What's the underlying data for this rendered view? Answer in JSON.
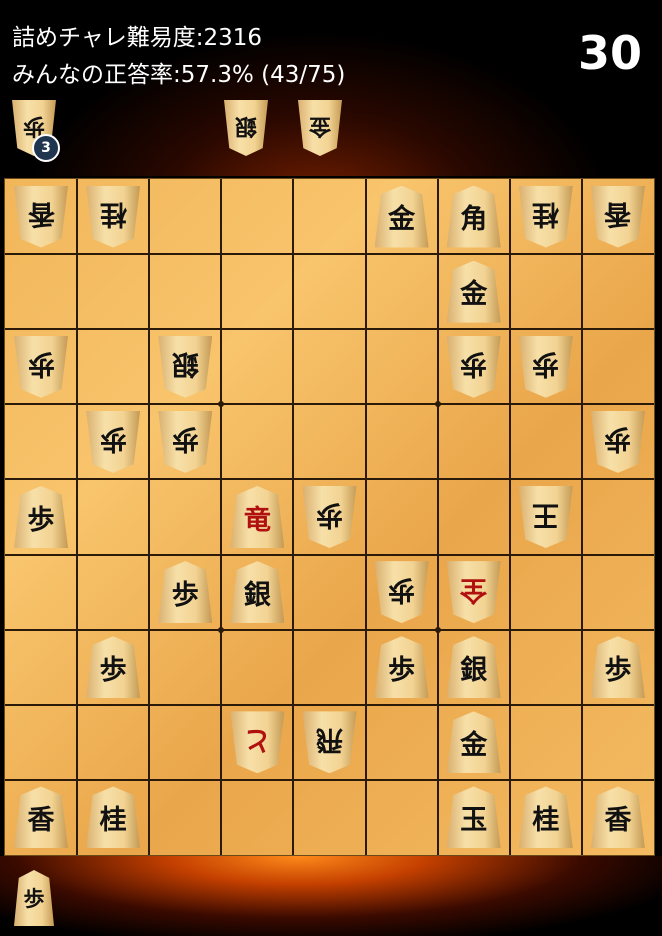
{
  "header": {
    "difficulty_text": "詰めチャレ難易度:2316",
    "accuracy_text": "みんなの正答率:57.3% (43/75)",
    "timer": "30"
  },
  "hands": {
    "opponent": [
      {
        "kanji": "歩",
        "count": "3"
      },
      {
        "kanji": "銀",
        "count": ""
      },
      {
        "kanji": "金",
        "count": ""
      }
    ],
    "player": [
      {
        "kanji": "歩",
        "count": ""
      }
    ]
  },
  "board": {
    "files": 9,
    "ranks": 9,
    "pieces": [
      {
        "row": 0,
        "col": 0,
        "kanji": "香",
        "owner": "gote"
      },
      {
        "row": 0,
        "col": 1,
        "kanji": "桂",
        "owner": "gote"
      },
      {
        "row": 0,
        "col": 5,
        "kanji": "金",
        "owner": "sente"
      },
      {
        "row": 0,
        "col": 6,
        "kanji": "角",
        "owner": "sente"
      },
      {
        "row": 0,
        "col": 7,
        "kanji": "桂",
        "owner": "gote"
      },
      {
        "row": 0,
        "col": 8,
        "kanji": "香",
        "owner": "gote"
      },
      {
        "row": 1,
        "col": 6,
        "kanji": "金",
        "owner": "sente"
      },
      {
        "row": 2,
        "col": 0,
        "kanji": "歩",
        "owner": "gote"
      },
      {
        "row": 2,
        "col": 2,
        "kanji": "銀",
        "owner": "gote"
      },
      {
        "row": 2,
        "col": 6,
        "kanji": "歩",
        "owner": "gote"
      },
      {
        "row": 2,
        "col": 7,
        "kanji": "歩",
        "owner": "gote"
      },
      {
        "row": 3,
        "col": 1,
        "kanji": "歩",
        "owner": "gote"
      },
      {
        "row": 3,
        "col": 2,
        "kanji": "歩",
        "owner": "gote"
      },
      {
        "row": 3,
        "col": 8,
        "kanji": "歩",
        "owner": "gote"
      },
      {
        "row": 4,
        "col": 0,
        "kanji": "歩",
        "owner": "sente"
      },
      {
        "row": 4,
        "col": 3,
        "kanji": "竜",
        "owner": "sente",
        "red": true
      },
      {
        "row": 4,
        "col": 4,
        "kanji": "歩",
        "owner": "gote"
      },
      {
        "row": 4,
        "col": 7,
        "kanji": "王",
        "owner": "gote"
      },
      {
        "row": 5,
        "col": 2,
        "kanji": "歩",
        "owner": "sente"
      },
      {
        "row": 5,
        "col": 3,
        "kanji": "銀",
        "owner": "sente"
      },
      {
        "row": 5,
        "col": 5,
        "kanji": "歩",
        "owner": "gote"
      },
      {
        "row": 5,
        "col": 6,
        "kanji": "全",
        "owner": "gote",
        "red": true
      },
      {
        "row": 6,
        "col": 1,
        "kanji": "歩",
        "owner": "sente"
      },
      {
        "row": 6,
        "col": 5,
        "kanji": "歩",
        "owner": "sente"
      },
      {
        "row": 6,
        "col": 6,
        "kanji": "銀",
        "owner": "sente"
      },
      {
        "row": 6,
        "col": 8,
        "kanji": "歩",
        "owner": "sente"
      },
      {
        "row": 7,
        "col": 3,
        "kanji": "と",
        "owner": "gote",
        "red": true
      },
      {
        "row": 7,
        "col": 4,
        "kanji": "飛",
        "owner": "gote"
      },
      {
        "row": 7,
        "col": 6,
        "kanji": "金",
        "owner": "sente"
      },
      {
        "row": 8,
        "col": 0,
        "kanji": "香",
        "owner": "sente"
      },
      {
        "row": 8,
        "col": 1,
        "kanji": "桂",
        "owner": "sente"
      },
      {
        "row": 8,
        "col": 6,
        "kanji": "玉",
        "owner": "sente"
      },
      {
        "row": 8,
        "col": 7,
        "kanji": "桂",
        "owner": "sente"
      },
      {
        "row": 8,
        "col": 8,
        "kanji": "香",
        "owner": "sente"
      }
    ]
  },
  "colors": {
    "board": "#f4bb62",
    "grid": "#2b1a08",
    "promoted_text": "#b01010",
    "badge": "#1f3550"
  }
}
